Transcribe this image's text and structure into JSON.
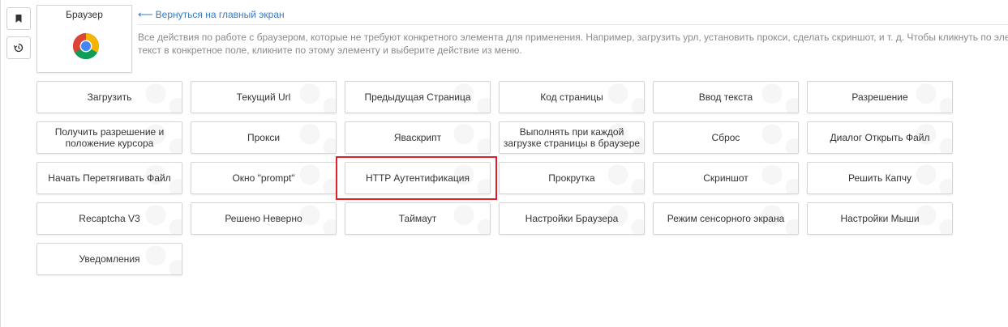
{
  "sidebar": {
    "bookmark_icon": "bookmark-icon",
    "history_icon": "history-icon"
  },
  "card": {
    "title": "Браузер",
    "icon": "chrome-logo"
  },
  "back_link": {
    "label": "Вернуться на главный экран"
  },
  "description": {
    "line1": "Все действия по работе с браузером, которые не требуют конкретного элемента для применения. Например, загрузить урл, установить прокси, сделать скриншот, и т. д. Чтобы кликнуть по элементу",
    "line2": "текст в конкретное поле, кликните по этому элементу и выберите действие из меню."
  },
  "actions": [
    [
      "Загрузить",
      "Текущий Url",
      "Предыдущая Страница",
      "Код страницы",
      "Ввод текста",
      "Разрешение"
    ],
    [
      "Получить разрешение и положение курсора",
      "Прокси",
      "Яваскрипт",
      "Выполнять при каждой загрузке страницы в браузере",
      "Сброс",
      "Диалог Открыть Файл"
    ],
    [
      "Начать Перетягивать Файл",
      "Окно \"prompt\"",
      "HTTP Аутентификация",
      "Прокрутка",
      "Скриншот",
      "Решить Капчу"
    ],
    [
      "Recaptcha V3",
      "Решено Неверно",
      "Таймаут",
      "Настройки Браузера",
      "Режим сенсорного экрана",
      "Настройки Мыши"
    ],
    [
      "Уведомления"
    ]
  ],
  "highlighted_action": "HTTP Аутентификация",
  "colors": {
    "link": "#3a7bbf",
    "highlight": "#e0202a"
  }
}
